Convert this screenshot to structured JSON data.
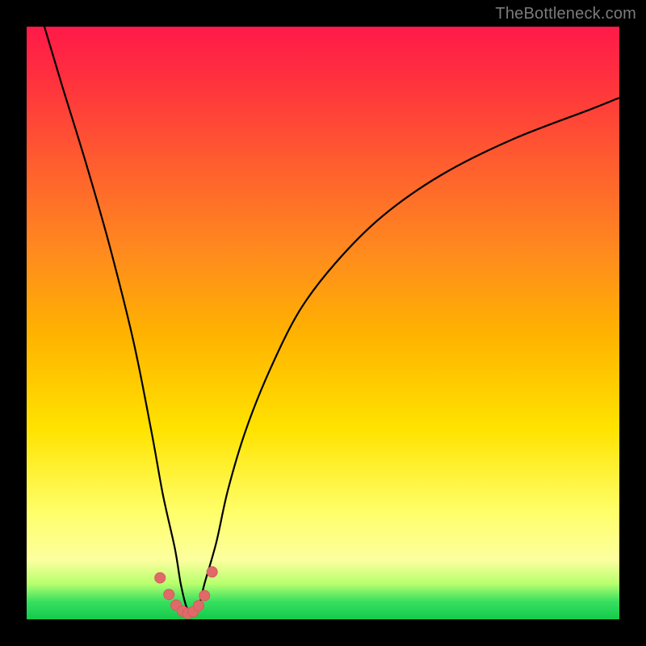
{
  "watermark": {
    "text": "TheBottleneck.com"
  },
  "colors": {
    "frame": "#000000",
    "curve": "#000000",
    "marker_fill": "#e06a6a",
    "marker_stroke": "#d85a5a",
    "gradient_top": "#ff1a49",
    "gradient_mid1": "#ff8a1e",
    "gradient_mid2": "#ffe300",
    "gradient_bottom": "#14c94b"
  },
  "chart_data": {
    "type": "line",
    "title": "",
    "xlabel": "",
    "ylabel": "",
    "xlim": [
      0,
      100
    ],
    "ylim": [
      0,
      100
    ],
    "note": "x and y are in percent of plot width/height; y=0 is bottom, y=100 is top. Curve is a V-shaped bottleneck profile with minimum near x≈27.",
    "series": [
      {
        "name": "bottleneck-curve",
        "x": [
          3,
          6,
          10,
          14,
          18,
          21,
          23,
          25,
          26,
          27,
          28,
          29,
          30,
          32,
          34,
          37,
          41,
          46,
          52,
          60,
          70,
          82,
          95,
          100
        ],
        "y": [
          100,
          90,
          77,
          63,
          47,
          32,
          21,
          12,
          6,
          2,
          1,
          2,
          6,
          13,
          22,
          32,
          42,
          52,
          60,
          68,
          75,
          81,
          86,
          88
        ]
      }
    ],
    "markers": {
      "name": "near-minimum-dots",
      "x": [
        22.5,
        24.0,
        25.2,
        26.3,
        27.2,
        28.1,
        29.0,
        30.0,
        31.3
      ],
      "y": [
        7.0,
        4.2,
        2.4,
        1.4,
        1.0,
        1.3,
        2.3,
        4.0,
        8.0
      ]
    }
  }
}
